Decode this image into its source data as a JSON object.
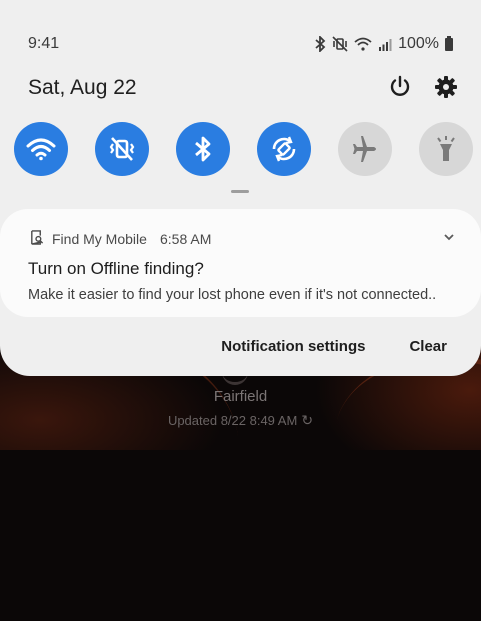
{
  "status_bar": {
    "time": "9:41",
    "battery_percent": "100%",
    "icons": [
      "bluetooth-icon",
      "vibrate-icon",
      "wifi-icon",
      "signal-icon",
      "battery-icon"
    ]
  },
  "quick_panel": {
    "date": "Sat, Aug 22",
    "top_actions": [
      "power-icon",
      "gear-icon"
    ],
    "tiles": [
      {
        "name": "wifi",
        "state": "on"
      },
      {
        "name": "vibrate",
        "state": "on"
      },
      {
        "name": "bluetooth",
        "state": "on"
      },
      {
        "name": "auto-rotate",
        "state": "on"
      },
      {
        "name": "airplane",
        "state": "off"
      },
      {
        "name": "flashlight",
        "state": "off"
      }
    ],
    "colors": {
      "tile_on": "#2a7de1",
      "tile_off": "#d7d7d7",
      "panel_bg": "#efefef"
    }
  },
  "notification": {
    "app_name": "Find My Mobile",
    "time": "6:58 AM",
    "title": "Turn on Offline finding?",
    "body": "Make it easier to find your lost phone even if it's not connected.."
  },
  "actions": {
    "settings_label": "Notification settings",
    "clear_label": "Clear"
  },
  "weather": {
    "city": "Fairfield",
    "updated": "Updated 8/22 8:49 AM"
  }
}
